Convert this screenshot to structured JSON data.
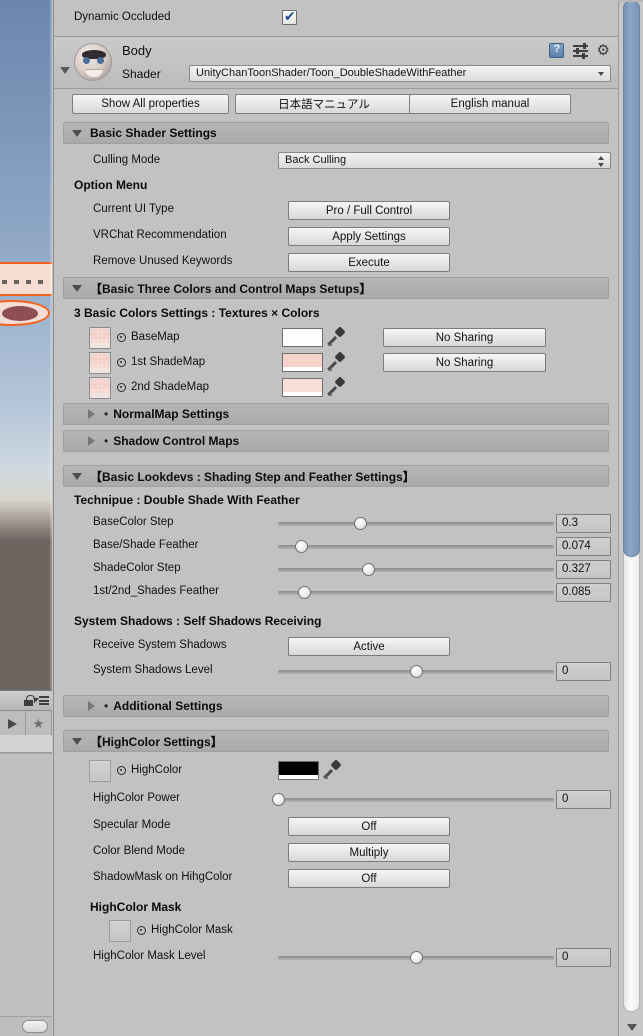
{
  "occluded": {
    "label": "Dynamic Occluded",
    "checked": true
  },
  "material": {
    "name": "Body",
    "shader_label": "Shader",
    "shader_value": "UnityChanToonShader/Toon_DoubleShadeWithFeather",
    "icons": {
      "help": "help-book-icon",
      "preset": "preset-icon",
      "gear": "gear-icon"
    }
  },
  "top_buttons": {
    "show_all": "Show All properties",
    "japanese_manual": "日本語マニュアル",
    "english_manual": "English manual"
  },
  "basic_shader_settings": {
    "header": "Basic Shader Settings",
    "culling_mode": {
      "label": "Culling Mode",
      "value": "Back Culling"
    },
    "option_menu_title": "Option Menu",
    "rows": [
      {
        "label": "Current UI Type",
        "button": "Pro / Full Control"
      },
      {
        "label": "VRChat Recommendation",
        "button": "Apply Settings"
      },
      {
        "label": "Remove Unused Keywords",
        "button": "Execute"
      }
    ]
  },
  "basic_three_colors": {
    "header": "【Basic Three Colors and Control Maps Setups】",
    "subtitle": "3 Basic Colors Settings : Textures × Colors",
    "maps": [
      {
        "label": "BaseMap",
        "color": "#fdfdfd",
        "sharing": "No Sharing"
      },
      {
        "label": "1st ShadeMap",
        "color": "#f7d2c9",
        "sharing": "No Sharing"
      },
      {
        "label": "2nd ShadeMap",
        "color": "#f9ddd7",
        "sharing": ""
      }
    ],
    "collapsed": [
      {
        "label": "NormalMap Settings"
      },
      {
        "label": "Shadow Control Maps"
      }
    ]
  },
  "basic_lookdevs": {
    "header": "【Basic Lookdevs : Shading Step and Feather Settings】",
    "technique_title": "Technipue : Double Shade With Feather",
    "sliders": [
      {
        "label": "BaseColor Step",
        "value": "0.3",
        "fraction": 0.3
      },
      {
        "label": "Base/Shade Feather",
        "value": "0.074",
        "fraction": 0.085
      },
      {
        "label": "ShadeColor Step",
        "value": "0.327",
        "fraction": 0.327
      },
      {
        "label": "1st/2nd_Shades Feather",
        "value": "0.085",
        "fraction": 0.095
      }
    ],
    "system_shadows_title": "System Shadows : Self Shadows Receiving",
    "receive_system_shadows": {
      "label": "Receive System Shadows",
      "button": "Active"
    },
    "system_shadows_level": {
      "label": "System Shadows Level",
      "value": "0",
      "fraction": 0.5
    },
    "additional_settings": "Additional Settings"
  },
  "highcolor_settings": {
    "header": "【HighColor Settings】",
    "highcolor": {
      "label": "HighColor",
      "color": "#000000"
    },
    "power": {
      "label": "HighColor Power",
      "value": "0",
      "fraction": 0.0
    },
    "rows": [
      {
        "label": "Specular Mode",
        "button": "Off"
      },
      {
        "label": "Color Blend Mode",
        "button": "Multiply"
      },
      {
        "label": "ShadowMask on HihgColor",
        "button": "Off"
      }
    ],
    "mask_title": "HighColor Mask",
    "mask": {
      "label": "HighColor Mask"
    },
    "mask_level": {
      "label": "HighColor Mask Level",
      "value": "0",
      "fraction": 0.5
    }
  },
  "scrollbar": {
    "name": "inspector-vertical-scrollbar"
  }
}
